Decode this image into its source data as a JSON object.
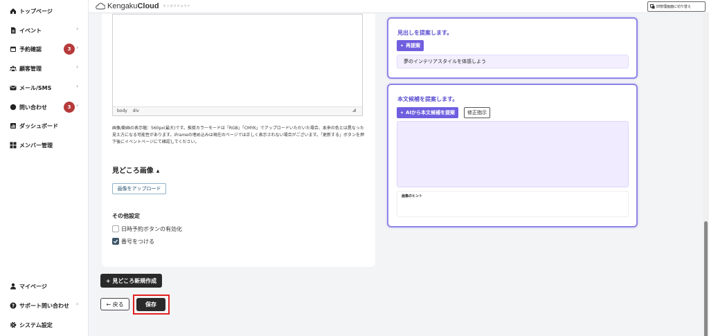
{
  "app": {
    "logo_main": "Kengaku",
    "logo_bold": "Cloud",
    "logo_sub": "ケンガククラウド",
    "admin_switch_label": "旧管理画面に切り替え"
  },
  "sidebar": {
    "items": [
      {
        "label": "トップページ",
        "icon": "home-icon"
      },
      {
        "label": "イベント",
        "icon": "document-icon",
        "chevron": "›"
      },
      {
        "label": "予約確認",
        "icon": "calendar-icon",
        "badge": "3",
        "chevron": "›"
      },
      {
        "label": "顧客管理",
        "icon": "users-icon",
        "chevron": "›"
      },
      {
        "label": "メール/SMS",
        "icon": "mail-icon",
        "chevron": "›"
      },
      {
        "label": "問い合わせ",
        "icon": "chat-icon",
        "badge": "3",
        "chevron": "›"
      },
      {
        "label": "ダッシュボード",
        "icon": "chart-icon"
      },
      {
        "label": "メンバー管理",
        "icon": "grid-icon"
      }
    ],
    "bottom_items": [
      {
        "label": "マイページ",
        "icon": "person-icon"
      },
      {
        "label": "サポート問い合わせ",
        "icon": "help-icon",
        "chevron": "›"
      },
      {
        "label": "システム設定",
        "icon": "gear-icon"
      }
    ]
  },
  "editor": {
    "status_path": [
      "body",
      "div"
    ],
    "note": "画像/動画の表示幅：560px(最大)です。推奨カラーモードは「RGB」「CMYK」でアップロードいただいた場合、本来の色とは異なった見え方になる可能性があります。iFrameの埋め込みは現在のページでは正しく表示されない場合がございます。「更新する」ボタンを押下後にイベントページにて確認してください。"
  },
  "highlights": {
    "title": "見どころ画像",
    "upload_label": "画像をアップロード"
  },
  "other_settings": {
    "title": "その他設定",
    "options": [
      {
        "label": "日時予約ボタンの有効化",
        "checked": false
      },
      {
        "label": "番号をつける",
        "checked": true
      }
    ]
  },
  "actions": {
    "new_highlight": "+ 見どころ新規作成",
    "back": "← 戻る",
    "save": "保存"
  },
  "ai_heading": {
    "title": "見出しを提案します。",
    "regen_label": "再提案",
    "suggestion": "夢のインテリアスタイルを体感しよう"
  },
  "ai_body": {
    "title": "本文候補を提案します。",
    "generate_label": "AIから本文候補を提案",
    "fix_label": "修正指示",
    "image_hint_label": "画像のヒント"
  },
  "colors": {
    "accent": "#6f5fe0",
    "badge": "#b63a3a",
    "highlight_border": "#e02020"
  }
}
